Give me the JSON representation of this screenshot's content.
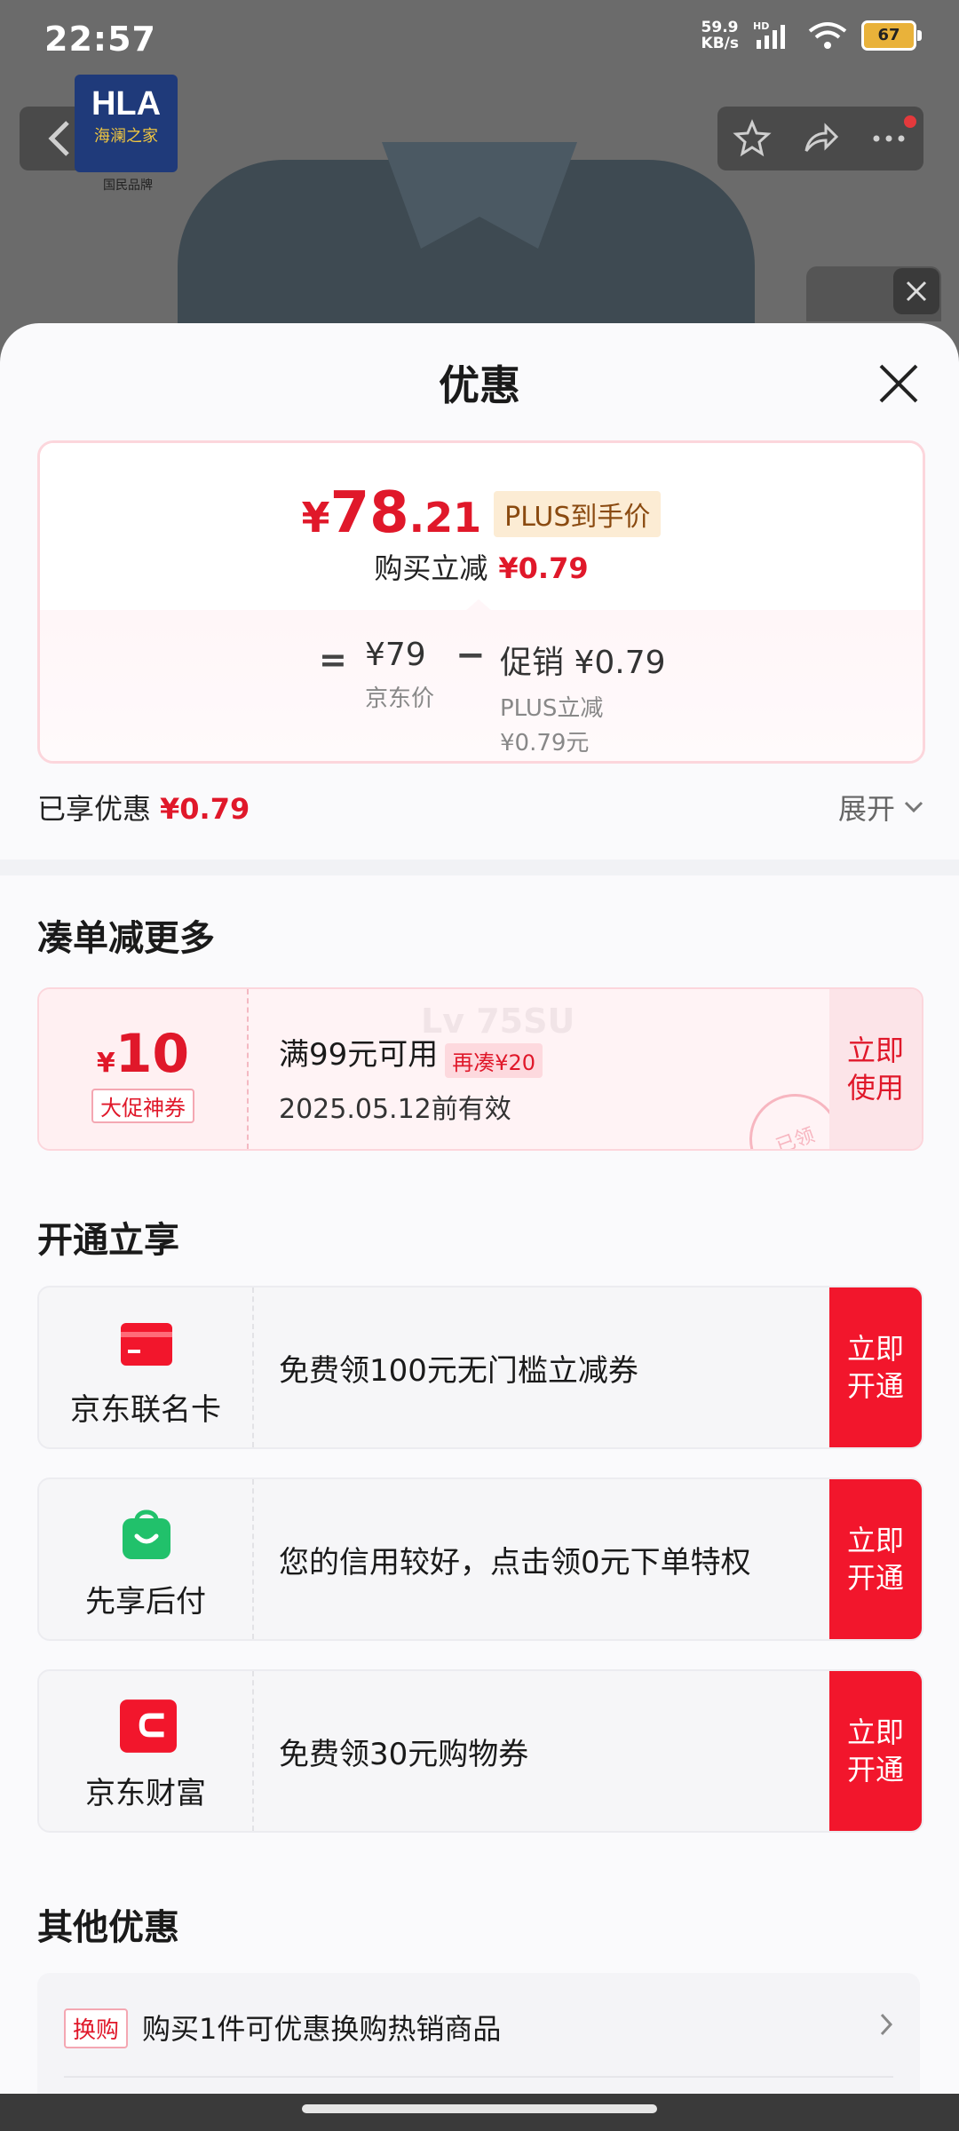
{
  "status": {
    "time": "22:57",
    "net_speed_value": "59.9",
    "net_speed_unit": "KB/s",
    "hd": "HD",
    "battery": "67"
  },
  "background_page": {
    "logo_text": "HLA",
    "logo_sub": "海澜之家",
    "logo_caption": "国民品牌"
  },
  "sheet": {
    "title": "优惠",
    "price": {
      "currency": "¥",
      "integer": "78",
      "decimal": ".21",
      "plus_tag": "PLUS到手价",
      "reduce_label": "购买立减",
      "reduce_value": "¥0.79"
    },
    "calc": {
      "equals": "=",
      "jd_price": "¥79",
      "jd_price_label": "京东价",
      "minus": "−",
      "promo": "促销 ¥0.79",
      "promo_sub1": "PLUS立减",
      "promo_sub2": "¥0.79元"
    },
    "enjoyed_label": "已享优惠",
    "enjoyed_value": "¥0.79",
    "expand_label": "展开"
  },
  "section_more": {
    "title": "凑单减更多",
    "coupon": {
      "currency": "¥",
      "amount": "10",
      "tag": "大促神券",
      "condition": "满99元可用",
      "extra": "再凑¥20",
      "valid": "2025.05.12前有效",
      "action": "立即使用",
      "stamp": "已领",
      "watermark": "Lv 75SU"
    }
  },
  "section_open": {
    "title": "开通立享",
    "items": [
      {
        "name": "京东联名卡",
        "desc": "免费领100元无门槛立减券",
        "action": "立即开通",
        "icon": "red-card-icon",
        "color": "#f2162c"
      },
      {
        "name": "先享后付",
        "desc": "您的信用较好，点击领0元下单特权",
        "action": "立即开通",
        "icon": "green-bag-icon",
        "color": "#21c16b"
      },
      {
        "name": "京东财富",
        "desc": "免费领30元购物券",
        "action": "立即开通",
        "icon": "wealth-wallet-icon",
        "color": "#f2162c"
      }
    ]
  },
  "section_other": {
    "title": "其他优惠",
    "tag": "换购",
    "text": "购买1件可优惠换购热销商品"
  },
  "colors": {
    "accent_red": "#e0182a",
    "button_red": "#f2162c",
    "plus_gold": "#fcecd4"
  }
}
